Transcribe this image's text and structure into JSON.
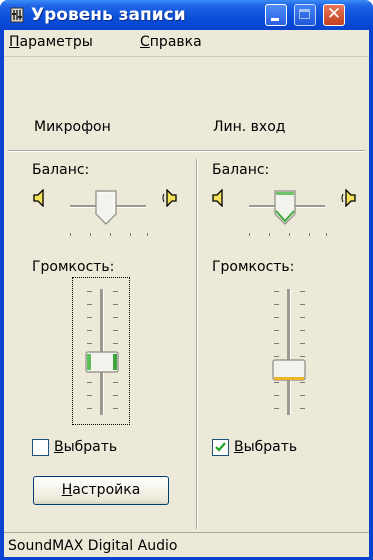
{
  "window": {
    "title": "Уровень записи",
    "close_glyph": "✕"
  },
  "menu": [
    {
      "label_u": "П",
      "label_rest": "араметры"
    },
    {
      "label_u": "С",
      "label_rest": "правка"
    }
  ],
  "channels": [
    {
      "name": "Микрофон",
      "balance_label": "Баланс:",
      "volume_label": "Громкость:",
      "select_label_u": "В",
      "select_label_rest": "ыбрать",
      "selected": false,
      "balance_value": 0.5,
      "volume_value": 0.4,
      "settings_button_u": "Н",
      "settings_button_rest": "астройка"
    },
    {
      "name": "Лин. вход",
      "balance_label": "Баланс:",
      "volume_label": "Громкость:",
      "select_label_u": "В",
      "select_label_rest": "ыбрать",
      "selected": true,
      "balance_value": 0.5,
      "volume_value": 0.33
    }
  ],
  "status": {
    "text": "SoundMAX Digital Audio"
  },
  "icons": {
    "app": "speaker-app-icon",
    "left_speaker": "speaker-left-icon",
    "right_speaker": "speaker-right-icon",
    "check": "checkmark-icon"
  }
}
